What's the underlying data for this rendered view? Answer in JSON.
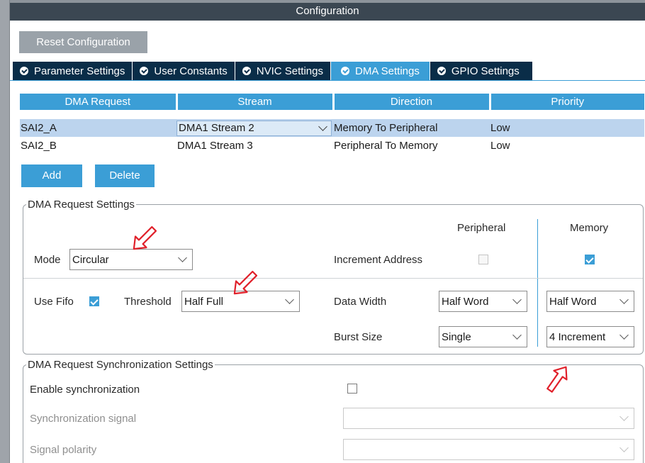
{
  "window": {
    "title": "Configuration"
  },
  "toolbar": {
    "reset_label": "Reset Configuration"
  },
  "tabs": [
    {
      "label": "Parameter Settings",
      "active": false
    },
    {
      "label": "User Constants",
      "active": false
    },
    {
      "label": "NVIC Settings",
      "active": false
    },
    {
      "label": "DMA Settings",
      "active": true
    },
    {
      "label": "GPIO Settings",
      "active": false
    }
  ],
  "dma_table": {
    "columns": [
      "DMA Request",
      "Stream",
      "Direction",
      "Priority"
    ],
    "rows": [
      {
        "request": "SAI2_A",
        "stream": "DMA1 Stream 2",
        "direction": "Memory To Peripheral",
        "priority": "Low",
        "selected": true
      },
      {
        "request": "SAI2_B",
        "stream": "DMA1 Stream 3",
        "direction": "Peripheral To Memory",
        "priority": "Low",
        "selected": false
      }
    ]
  },
  "actions": {
    "add_label": "Add",
    "delete_label": "Delete"
  },
  "request_settings": {
    "legend": "DMA Request Settings",
    "col_peripheral": "Peripheral",
    "col_memory": "Memory",
    "mode_label": "Mode",
    "mode_value": "Circular",
    "increment_label": "Increment Address",
    "increment_peripheral": false,
    "increment_memory": true,
    "use_fifo_label": "Use Fifo",
    "use_fifo": true,
    "threshold_label": "Threshold",
    "threshold_value": "Half Full",
    "data_width_label": "Data Width",
    "data_width_peripheral": "Half Word",
    "data_width_memory": "Half Word",
    "burst_size_label": "Burst Size",
    "burst_peripheral": "Single",
    "burst_memory": "4 Increment"
  },
  "sync_settings": {
    "legend": "DMA Request Synchronization Settings",
    "enable_label": "Enable synchronization",
    "enable": false,
    "signal_label": "Synchronization signal",
    "signal_value": "",
    "polarity_label": "Signal polarity",
    "polarity_value": ""
  },
  "colors": {
    "accent": "#3b9ed6",
    "tab_bg": "#0a2d48",
    "title_bg": "#3b4752",
    "annotation_arrow": "#e0202a"
  },
  "annotations": {
    "arrow_icon": "red-outline-arrow-icon"
  }
}
